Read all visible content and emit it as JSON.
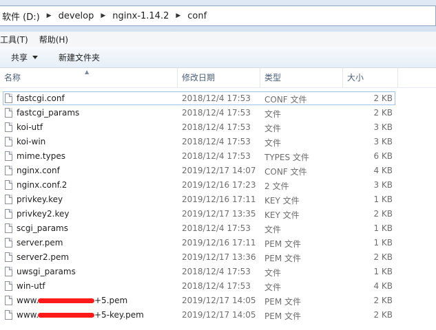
{
  "address_bar": {
    "crumbs": [
      "软件 (D:)",
      "develop",
      "nginx-1.14.2",
      "conf"
    ]
  },
  "menu": {
    "items": [
      "工具(T)",
      "帮助(H)"
    ]
  },
  "toolbar": {
    "share_label": "共享",
    "new_folder_label": "新建文件夹"
  },
  "columns": {
    "name": "名称",
    "modified": "修改日期",
    "type": "类型",
    "size": "大小"
  },
  "files": [
    {
      "name": "fastcgi.conf",
      "modified": "2018/12/4 17:53",
      "type": "CONF 文件",
      "size": "2 KB",
      "selected": true
    },
    {
      "name": "fastcgi_params",
      "modified": "2018/12/4 17:53",
      "type": "文件",
      "size": "2 KB"
    },
    {
      "name": "koi-utf",
      "modified": "2018/12/4 17:53",
      "type": "文件",
      "size": "3 KB"
    },
    {
      "name": "koi-win",
      "modified": "2018/12/4 17:53",
      "type": "文件",
      "size": "3 KB"
    },
    {
      "name": "mime.types",
      "modified": "2018/12/4 17:53",
      "type": "TYPES 文件",
      "size": "6 KB"
    },
    {
      "name": "nginx.conf",
      "modified": "2019/12/17 14:07",
      "type": "CONF 文件",
      "size": "4 KB"
    },
    {
      "name": "nginx.conf.2",
      "modified": "2019/12/16 17:23",
      "type": "2 文件",
      "size": "3 KB"
    },
    {
      "name": "privkey.key",
      "modified": "2019/12/16 17:11",
      "type": "KEY 文件",
      "size": "1 KB"
    },
    {
      "name": "privkey2.key",
      "modified": "2019/12/17 13:35",
      "type": "KEY 文件",
      "size": "2 KB"
    },
    {
      "name": "scgi_params",
      "modified": "2018/12/4 17:53",
      "type": "文件",
      "size": "1 KB"
    },
    {
      "name": "server.pem",
      "modified": "2019/12/16 17:11",
      "type": "PEM 文件",
      "size": "1 KB"
    },
    {
      "name": "server2.pem",
      "modified": "2019/12/17 13:36",
      "type": "PEM 文件",
      "size": "2 KB"
    },
    {
      "name": "uwsgi_params",
      "modified": "2018/12/4 17:53",
      "type": "文件",
      "size": "1 KB"
    },
    {
      "name": "win-utf",
      "modified": "2018/12/4 17:53",
      "type": "文件",
      "size": "4 KB"
    },
    {
      "name": "www.",
      "name_suffix": "+5.pem",
      "redacted": true,
      "modified": "2019/12/17 14:05",
      "type": "PEM 文件",
      "size": "2 KB"
    },
    {
      "name": "www.",
      "name_suffix": "+5-key.pem",
      "redacted": true,
      "modified": "2019/12/17 14:05",
      "type": "PEM 文件",
      "size": "2 KB"
    }
  ],
  "colors": {
    "selection_border": "#9ec3e6",
    "redaction": "#ff1a1a"
  }
}
